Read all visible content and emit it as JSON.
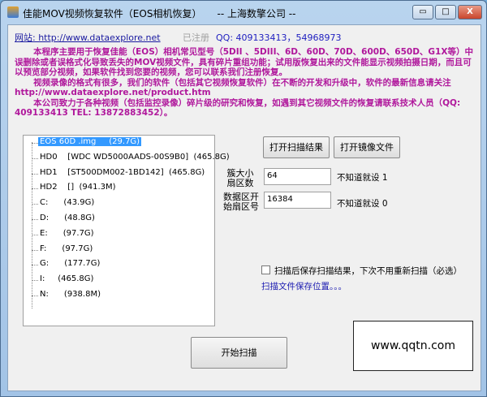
{
  "window": {
    "title": "佳能MOV视频恢复软件（EOS相机恢复）     -- 上海数擎公司 --",
    "minimize": "▭",
    "maximize": "□",
    "close": "X"
  },
  "header": {
    "website": "网站: http://www.dataexplore.net",
    "registered": "已注册",
    "qq": "QQ: 409133413，54968973"
  },
  "description": [
    "本程序主要用于恢复佳能（EOS）相机常见型号（5DII 、5DIII、6D、60D、70D、600D、650D、G1X等）中误删除或者误格式化导致丢失的MOV视频文件，具有碎片重组功能；试用版恢复出来的文件能显示视频拍摄日期，而且可以预览部分视频，如果软件找到您要的视频，您可以联系我们注册恢复。",
    "视频录像的格式有很多，我们的软件（包括其它视频恢复软件）在不断的开发和升级中，软件的最新信息请关注 http://www.dataexplore.net/product.htm",
    "本公司致力于各种视频（包括监控录像）碎片级的研究和恢复，如遇到其它视频文件的恢复请联系技术人员（QQ: 409133413 TEL: 13872883452）。"
  ],
  "tree": [
    {
      "label": "EOS 60D .img     (29.7G)",
      "selected": true
    },
    {
      "label": "HD0    [WDC WD5000AADS-00S9B0]  (465.8G)"
    },
    {
      "label": "HD1    [ST500DM002-1BD142]  (465.8G)"
    },
    {
      "label": "HD2    []  (941.3M)"
    },
    {
      "label": "C:      (43.9G)"
    },
    {
      "label": "D:      (48.8G)"
    },
    {
      "label": "E:      (97.7G)"
    },
    {
      "label": "F:      (97.7G)"
    },
    {
      "label": "G:      (177.7G)"
    },
    {
      "label": "I:     (465.8G)"
    },
    {
      "label": "N:      (938.8M)"
    }
  ],
  "buttons": {
    "open_scan": "打开扫描结果",
    "open_image": "打开镜像文件",
    "start_scan": "开始扫描"
  },
  "fields": {
    "cluster_label": "簇大小扇区数",
    "cluster_value": "64",
    "cluster_hint": "不知道就设 1",
    "start_label": "数据区开始扇区号",
    "start_value": "16384",
    "start_hint": "不知道就设 0"
  },
  "save_option": {
    "label": "扫描后保存扫描结果，下次不用重新扫描（必选）",
    "checked": false,
    "location_link": "扫描文件保存位置。。。"
  },
  "watermark": "www.qqtn.com"
}
